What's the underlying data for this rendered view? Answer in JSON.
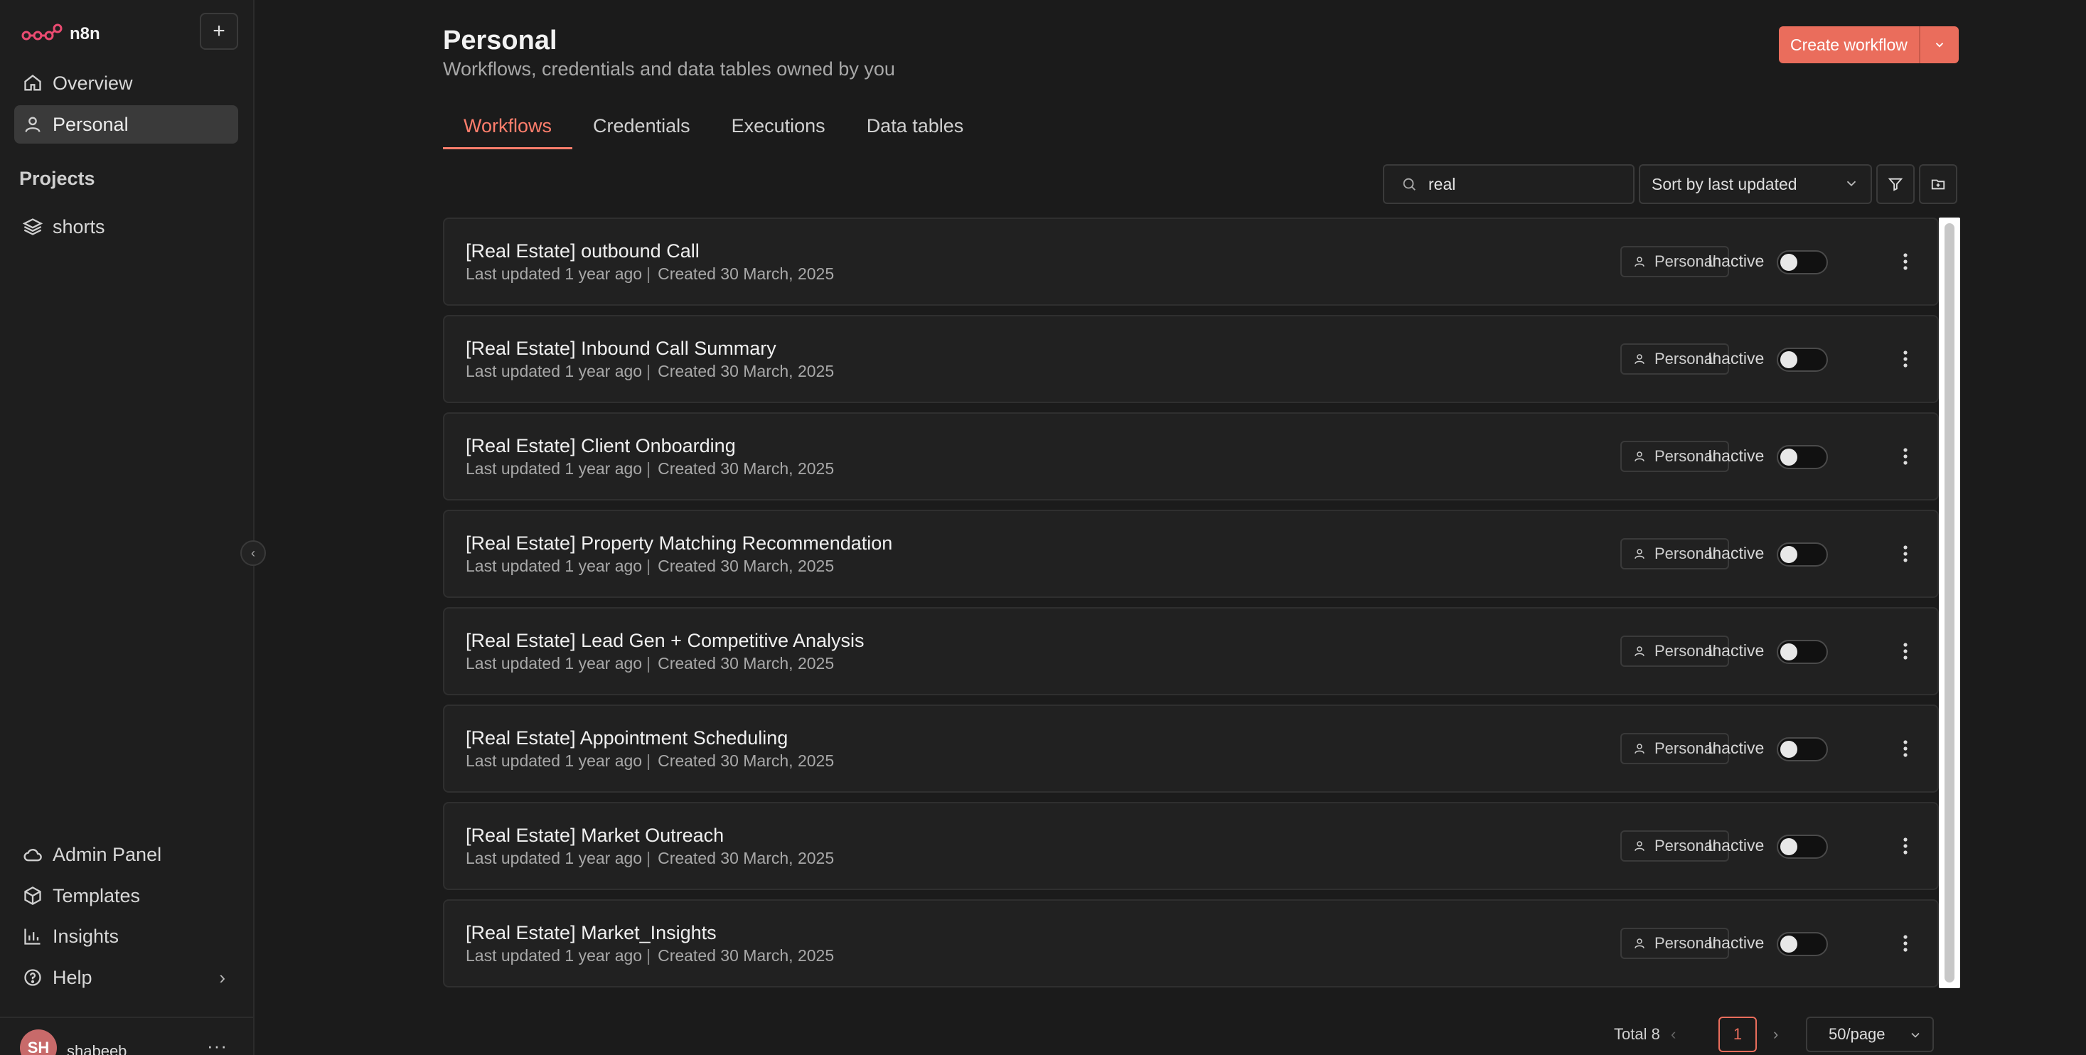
{
  "sidebar": {
    "brand": "n8n",
    "nav": [
      {
        "label": "Overview",
        "icon": "home-icon"
      },
      {
        "label": "Personal",
        "icon": "user-icon",
        "active": true
      }
    ],
    "projects_label": "Projects",
    "projects": [
      {
        "label": "shorts",
        "icon": "layers-icon"
      }
    ],
    "bottom": [
      {
        "label": "Admin Panel",
        "icon": "cloud-icon"
      },
      {
        "label": "Templates",
        "icon": "box-icon"
      },
      {
        "label": "Insights",
        "icon": "bar-chart-icon"
      },
      {
        "label": "Help",
        "icon": "help-circle-icon"
      }
    ],
    "user": {
      "initials": "SH",
      "name": "shabeeb"
    }
  },
  "header": {
    "title": "Personal",
    "subtitle": "Workflows, credentials and data tables owned by you",
    "create_label": "Create workflow"
  },
  "tabs": [
    {
      "label": "Workflows",
      "active": true
    },
    {
      "label": "Credentials"
    },
    {
      "label": "Executions"
    },
    {
      "label": "Data tables"
    }
  ],
  "toolbar": {
    "search_value": "real",
    "sort_label": "Sort by last updated"
  },
  "workflows": [
    {
      "name": "[Real Estate] outbound Call",
      "updated": "Last updated 1 year ago",
      "created": "Created 30 March, 2025",
      "owner": "Personal",
      "status": "Inactive"
    },
    {
      "name": "[Real Estate] Inbound Call Summary",
      "updated": "Last updated 1 year ago",
      "created": "Created 30 March, 2025",
      "owner": "Personal",
      "status": "Inactive"
    },
    {
      "name": "[Real Estate] Client Onboarding",
      "updated": "Last updated 1 year ago",
      "created": "Created 30 March, 2025",
      "owner": "Personal",
      "status": "Inactive"
    },
    {
      "name": "[Real Estate] Property Matching Recommendation",
      "updated": "Last updated 1 year ago",
      "created": "Created 30 March, 2025",
      "owner": "Personal",
      "status": "Inactive"
    },
    {
      "name": "[Real Estate] Lead Gen + Competitive Analysis",
      "updated": "Last updated 1 year ago",
      "created": "Created 30 March, 2025",
      "owner": "Personal",
      "status": "Inactive"
    },
    {
      "name": "[Real Estate] Appointment Scheduling",
      "updated": "Last updated 1 year ago",
      "created": "Created 30 March, 2025",
      "owner": "Personal",
      "status": "Inactive"
    },
    {
      "name": "[Real Estate] Market Outreach",
      "updated": "Last updated 1 year ago",
      "created": "Created 30 March, 2025",
      "owner": "Personal",
      "status": "Inactive"
    },
    {
      "name": "[Real Estate] Market_Insights",
      "updated": "Last updated 1 year ago",
      "created": "Created 30 March, 2025",
      "owner": "Personal",
      "status": "Inactive"
    }
  ],
  "pagination": {
    "total": "Total 8",
    "current_page": "1",
    "per_page": "50/page"
  },
  "colors": {
    "accent": "#ea6d5c",
    "background": "#1b1b1b",
    "sidebar": "#1e1e1e"
  }
}
